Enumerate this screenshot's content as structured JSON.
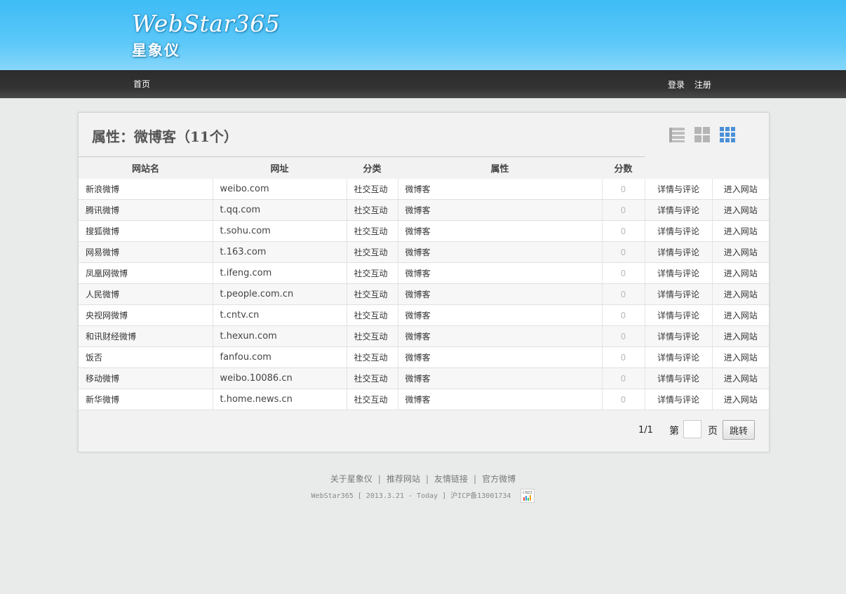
{
  "header": {
    "logo_en": "WebStar365",
    "logo_cn": "星象仪"
  },
  "nav": {
    "home": "首页",
    "login": "登录",
    "register": "注册"
  },
  "panel": {
    "title": "属性：微博客（11个）",
    "view_icons": [
      "list-view-icon",
      "grid-view-icon",
      "table-view-icon"
    ],
    "active_view_color": "#4a90d9"
  },
  "table": {
    "headers": [
      "网站名",
      "网址",
      "分类",
      "属性",
      "分数"
    ],
    "rows": [
      {
        "name": "新浪微博",
        "url": "weibo.com",
        "category": "社交互动",
        "attr": "微博客",
        "score": "0",
        "detail": "详情与评论",
        "visit": "进入网站"
      },
      {
        "name": "腾讯微博",
        "url": "t.qq.com",
        "category": "社交互动",
        "attr": "微博客",
        "score": "0",
        "detail": "详情与评论",
        "visit": "进入网站"
      },
      {
        "name": "搜狐微博",
        "url": "t.sohu.com",
        "category": "社交互动",
        "attr": "微博客",
        "score": "0",
        "detail": "详情与评论",
        "visit": "进入网站"
      },
      {
        "name": "网易微博",
        "url": "t.163.com",
        "category": "社交互动",
        "attr": "微博客",
        "score": "0",
        "detail": "详情与评论",
        "visit": "进入网站"
      },
      {
        "name": "凤凰网微博",
        "url": "t.ifeng.com",
        "category": "社交互动",
        "attr": "微博客",
        "score": "0",
        "detail": "详情与评论",
        "visit": "进入网站"
      },
      {
        "name": "人民微博",
        "url": "t.people.com.cn",
        "category": "社交互动",
        "attr": "微博客",
        "score": "0",
        "detail": "详情与评论",
        "visit": "进入网站"
      },
      {
        "name": "央视网微博",
        "url": "t.cntv.cn",
        "category": "社交互动",
        "attr": "微博客",
        "score": "0",
        "detail": "详情与评论",
        "visit": "进入网站"
      },
      {
        "name": "和讯财经微博",
        "url": "t.hexun.com",
        "category": "社交互动",
        "attr": "微博客",
        "score": "0",
        "detail": "详情与评论",
        "visit": "进入网站"
      },
      {
        "name": "饭否",
        "url": "fanfou.com",
        "category": "社交互动",
        "attr": "微博客",
        "score": "0",
        "detail": "详情与评论",
        "visit": "进入网站"
      },
      {
        "name": "移动微博",
        "url": "weibo.10086.cn",
        "category": "社交互动",
        "attr": "微博客",
        "score": "0",
        "detail": "详情与评论",
        "visit": "进入网站"
      },
      {
        "name": "新华微博",
        "url": "t.home.news.cn",
        "category": "社交互动",
        "attr": "微博客",
        "score": "0",
        "detail": "详情与评论",
        "visit": "进入网站"
      }
    ]
  },
  "pager": {
    "page_info": "1/1",
    "prefix": "第",
    "suffix": "页",
    "go_label": "跳转"
  },
  "footer": {
    "links": [
      "关于星象仪",
      "推荐网站",
      "友情链接",
      "官方微博"
    ],
    "copyright": "WebStar365 [ 2013.3.21 - Today ] 沪ICP备13001734",
    "stat_label": "CNZZ"
  }
}
